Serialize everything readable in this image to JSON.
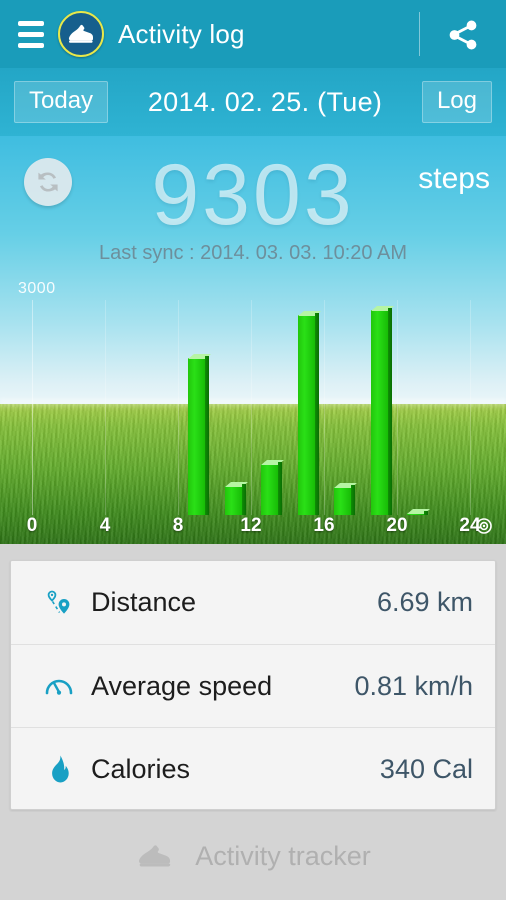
{
  "actionbar": {
    "menu_icon": "hamburger-icon",
    "app_icon": "shoe-app-icon",
    "title": "Activity log",
    "share_icon": "share-icon"
  },
  "datebar": {
    "today_label": "Today",
    "date_label": "2014. 02. 25. (Tue)",
    "log_label": "Log"
  },
  "hero": {
    "refresh_icon": "refresh-icon",
    "step_count": "9303",
    "steps_unit": "steps",
    "last_sync": "Last sync : 2014. 03. 03. 10:20 AM"
  },
  "chart_data": {
    "type": "bar",
    "title": "",
    "xlabel": "",
    "ylabel": "",
    "ymax_label": "3000",
    "ylim": [
      0,
      3000
    ],
    "xlim": [
      0,
      24
    ],
    "grid": true,
    "tick_labels": [
      "0",
      "4",
      "8",
      "12",
      "16",
      "20",
      "24"
    ],
    "tick_values": [
      0,
      4,
      8,
      12,
      16,
      20,
      24
    ],
    "goal_marker_icon": "goal-target-icon",
    "bar_color": "#22e00b",
    "categories": [
      9,
      11,
      13,
      15,
      17,
      19,
      21
    ],
    "values": [
      2190,
      405,
      710,
      2790,
      390,
      2860,
      30
    ]
  },
  "stats": {
    "rows": [
      {
        "icon": "route-pin-icon",
        "label": "Distance",
        "value": "6.69 km"
      },
      {
        "icon": "speedometer-icon",
        "label": "Average speed",
        "value": "0.81 km/h"
      },
      {
        "icon": "flame-icon",
        "label": "Calories",
        "value": "340 Cal"
      }
    ]
  },
  "footer": {
    "icon": "shoe-icon",
    "label": "Activity tracker"
  },
  "colors": {
    "accent": "#1a9cba",
    "datebar": "#2fb3d3",
    "bar_green": "#22e00b",
    "value_text": "#3e5668"
  }
}
